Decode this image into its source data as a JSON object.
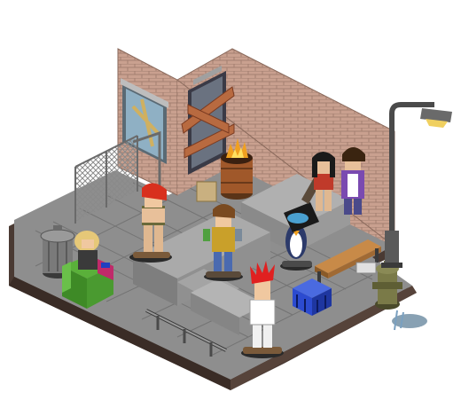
{
  "scene": {
    "kind": "isometric pixel-art game room",
    "theme": "urban skate park alley",
    "colors": {
      "background": "#ffffff",
      "floor_top": "#8e8e8e",
      "floor_tile_line": "#6f6f6f",
      "floor_side": "#4a3a33",
      "brick": "#c9a08f",
      "brick_mortar": "#9e7a6c",
      "concrete": "#9d9d9d",
      "concrete_dark": "#7a7a7a",
      "wood": "#b07a3a",
      "crate_blue": "#2c4bd0",
      "hydrant": "#6e6e44",
      "lamp": "#4a4a4a"
    }
  },
  "objects": {
    "walls": [
      "left-brick-wall",
      "right-brick-wall"
    ],
    "furniture": [
      "boarded-window",
      "boarded-door",
      "chain-link-fence",
      "burning-barrel",
      "trash-can",
      "green-armchair",
      "concrete-ramp",
      "concrete-ledge",
      "grind-rail",
      "wooden-bench",
      "blue-crate",
      "fire-hydrant",
      "street-lamp",
      "water-puddle"
    ]
  },
  "avatars": [
    {
      "id": "red-hair-skater",
      "hair": "#d8301e",
      "shirt": "none",
      "board": true
    },
    {
      "id": "brown-hair-skater",
      "hair": "#7a4a20",
      "shirt": "#c9a02a",
      "board": true
    },
    {
      "id": "mohawk-skater",
      "hair": "#e02020",
      "shirt": "#ffffff",
      "board": true
    },
    {
      "id": "penguin-skater",
      "hair": "#2c3a6a",
      "shirt": "#ffffff",
      "board": true
    },
    {
      "id": "blonde-seated",
      "hair": "#e6c878",
      "shirt": "#3a3a3a",
      "board": false
    },
    {
      "id": "dark-hair-girl",
      "hair": "#1a1a1a",
      "shirt": "#c03a2a",
      "board": true
    },
    {
      "id": "curly-hair-guy",
      "hair": "#3a2410",
      "shirt": "#7a4ab0",
      "board": false
    }
  ]
}
